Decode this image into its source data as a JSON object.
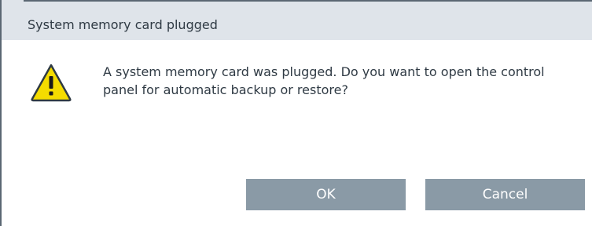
{
  "dialog": {
    "title": "System memory card plugged",
    "message": "A system memory card was plugged. Do you want to open the control panel for automatic backup or restore?",
    "icon": "warning-icon",
    "buttons": {
      "ok": "OK",
      "cancel": "Cancel"
    }
  },
  "colors": {
    "header_bg": "#dfe4ea",
    "button_bg": "#8a9aa6",
    "text": "#2f3a44",
    "warning_yellow": "#f5dc00"
  }
}
